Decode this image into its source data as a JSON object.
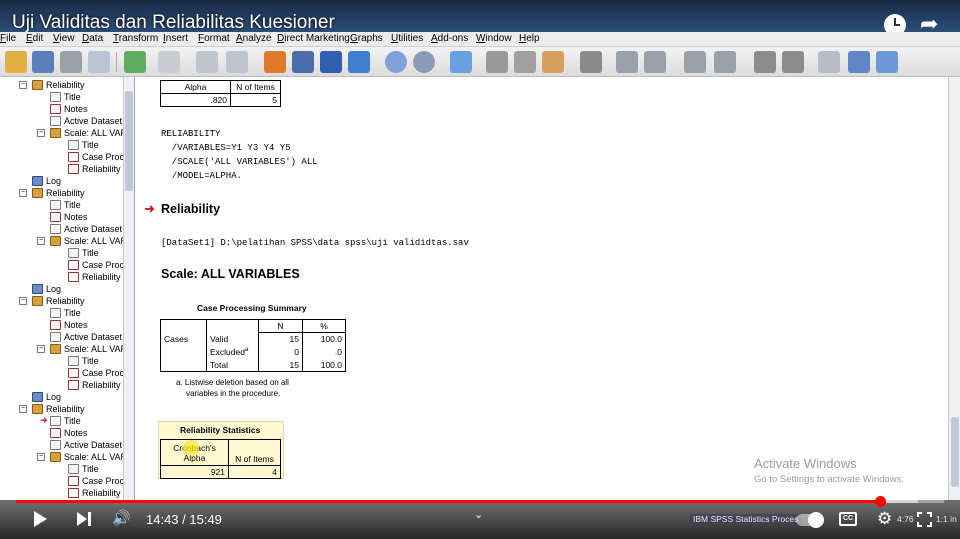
{
  "video": {
    "title": "Uji Validitas dan Reliabilitas Kuesioner",
    "current_time": "14:43",
    "duration": "15:49",
    "time_display": "14:43 / 15:49",
    "progress_fraction": 0.931,
    "buffer_fraction": 0.972
  },
  "menu": [
    "File",
    "Edit",
    "View",
    "Data",
    "Transform",
    "Insert",
    "Format",
    "Analyze",
    "Direct Marketing",
    "Graphs",
    "Utilities",
    "Add-ons",
    "Window",
    "Help"
  ],
  "tree": {
    "groups": [
      {
        "label": "Reliability",
        "items": [
          "Title",
          "Notes",
          "Active Dataset"
        ],
        "scale": "Scale: ALL VAR",
        "sub": [
          "Title",
          "Case Proc",
          "Reliability S"
        ]
      },
      {
        "log": "Log",
        "label": "Reliability",
        "items": [
          "Title",
          "Notes",
          "Active Dataset"
        ],
        "scale": "Scale: ALL VAR",
        "sub": [
          "Title",
          "Case Proc",
          "Reliability S"
        ]
      },
      {
        "log": "Log",
        "label": "Reliability",
        "items": [
          "Title",
          "Notes",
          "Active Dataset"
        ],
        "scale": "Scale: ALL VAR",
        "sub": [
          "Title",
          "Case Proc",
          "Reliability S"
        ]
      },
      {
        "log": "Log",
        "label": "Reliability",
        "items": [
          "Title",
          "Notes",
          "Active Dataset"
        ],
        "scale": "Scale: ALL VAR",
        "sub": [
          "Title",
          "Case Proc",
          "Reliability S"
        ]
      }
    ]
  },
  "output": {
    "prev_table": {
      "col1": "Alpha",
      "col2": "N of Items",
      "alpha": ".820",
      "n_items": "5"
    },
    "syntax": [
      "RELIABILITY",
      "  /VARIABLES=Y1 Y3 Y4 Y5",
      "  /SCALE('ALL VARIABLES') ALL",
      "  /MODEL=ALPHA."
    ],
    "section_heading": "Reliability",
    "dataset_line": "[DataSet1] D:\\pelatihan SPSS\\data spss\\uji valididtas.sav",
    "scale_heading": "Scale: ALL VARIABLES",
    "case_summary": {
      "title": "Case Processing Summary",
      "header_n": "N",
      "header_pct": "%",
      "group": "Cases",
      "rows": [
        {
          "label": "Valid",
          "n": "15",
          "pct": "100.0"
        },
        {
          "label": "Excluded",
          "sup": "a",
          "n": "0",
          "pct": ".0"
        },
        {
          "label": "Total",
          "n": "15",
          "pct": "100.0"
        }
      ],
      "footnote_1": "a. Listwise deletion based on all",
      "footnote_2": "variables in the procedure."
    },
    "reliability_stats": {
      "title": "Reliability Statistics",
      "col1_line1": "Cronbach's",
      "col1_line2": "Alpha",
      "col2": "N of Items",
      "alpha": ".921",
      "n_items": "4"
    }
  },
  "watermark": {
    "line1": "Activate Windows",
    "line2": "Go to Settings to activate Windows."
  },
  "player": {
    "taskbar_label": "IBM SPSS Statistics Proces",
    "tray_text": "4:76",
    "tray_time": "1:1 in",
    "cc_label": "CC"
  },
  "colors": {
    "accent_red": "#ff0000",
    "arrow_red": "#d00000",
    "tree_book": "#d9a040"
  }
}
